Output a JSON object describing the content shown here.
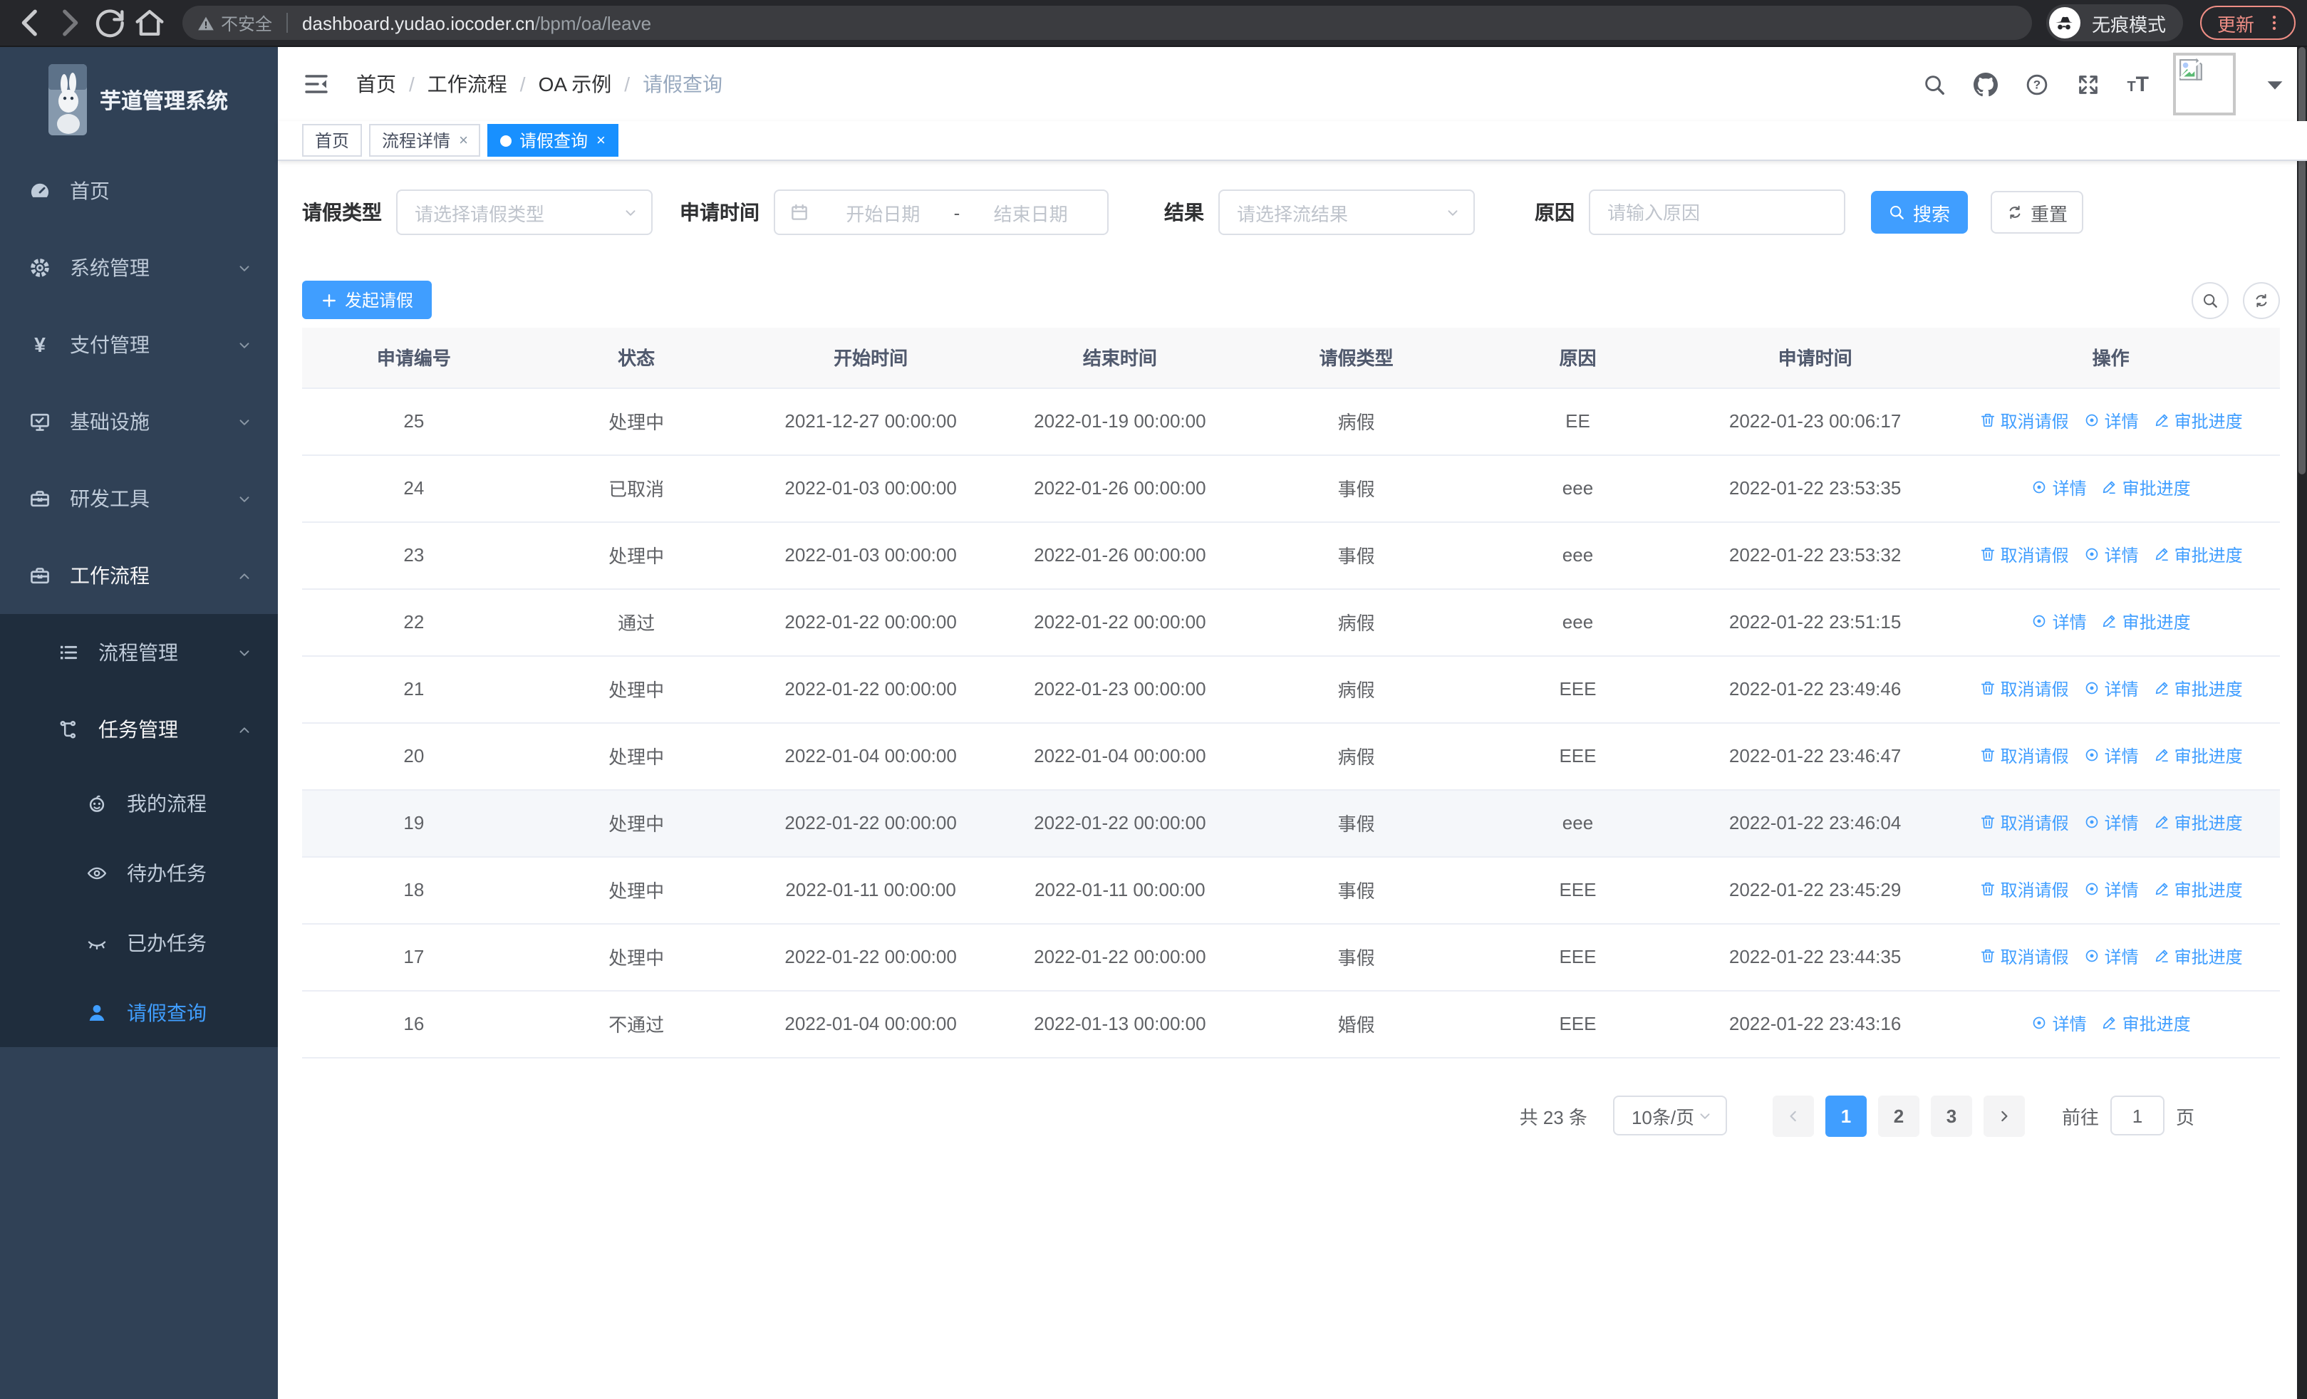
{
  "colors": {
    "primary": "#409eff",
    "tab_active": "#1890ff",
    "sidebar_bg": "#304156",
    "submenu_bg": "#1f2d3d",
    "link": "#409eff"
  },
  "browser": {
    "security_label": "不安全",
    "url_host": "dashboard.yudao.iocoder.cn",
    "url_path": "/bpm/oa/leave",
    "incognito_label": "无痕模式",
    "update_label": "更新"
  },
  "app": {
    "title": "芋道管理系统",
    "breadcrumb": [
      "首页",
      "工作流程",
      "OA 示例",
      "请假查询"
    ],
    "tabs": [
      {
        "key": "home",
        "label": "首页",
        "closable": false,
        "active": false
      },
      {
        "key": "process-detail",
        "label": "流程详情",
        "closable": true,
        "active": false
      },
      {
        "key": "leave-query",
        "label": "请假查询",
        "closable": true,
        "active": true
      }
    ]
  },
  "sidebar": {
    "items": [
      {
        "key": "home",
        "label": "首页",
        "icon": "dashboard-icon",
        "level": 1
      },
      {
        "key": "system",
        "label": "系统管理",
        "icon": "gear-icon",
        "level": 1,
        "chevron": "down"
      },
      {
        "key": "payment",
        "label": "支付管理",
        "icon": "yen-icon",
        "level": 1,
        "chevron": "down"
      },
      {
        "key": "infrastructure",
        "label": "基础设施",
        "icon": "monitor-icon",
        "level": 1,
        "chevron": "down"
      },
      {
        "key": "dev-tools",
        "label": "研发工具",
        "icon": "toolbox-icon",
        "level": 1,
        "chevron": "down"
      },
      {
        "key": "workflow",
        "label": "工作流程",
        "icon": "briefcase-icon",
        "level": 1,
        "chevron": "up",
        "open": true
      },
      {
        "key": "process-mgmt",
        "label": "流程管理",
        "icon": "list-icon",
        "level": 2,
        "chevron": "down"
      },
      {
        "key": "task-mgmt",
        "label": "任务管理",
        "icon": "tree-icon",
        "level": 2,
        "chevron": "up",
        "open": true
      },
      {
        "key": "my-process",
        "label": "我的流程",
        "icon": "robot-icon",
        "level": 3
      },
      {
        "key": "todo-task",
        "label": "待办任务",
        "icon": "eye-icon",
        "level": 3
      },
      {
        "key": "done-task",
        "label": "已办任务",
        "icon": "eye-closed-icon",
        "level": 3
      },
      {
        "key": "leave-query",
        "label": "请假查询",
        "icon": "user-icon",
        "level": 3,
        "active": true
      }
    ]
  },
  "filters": {
    "leave_type_label": "请假类型",
    "leave_type_placeholder": "请选择请假类型",
    "apply_time_label": "申请时间",
    "start_placeholder": "开始日期",
    "range_separator": "-",
    "end_placeholder": "结束日期",
    "result_label": "结果",
    "result_placeholder": "请选择流结果",
    "reason_label": "原因",
    "reason_placeholder": "请输入原因",
    "search_label": "搜索",
    "reset_label": "重置"
  },
  "toolbar": {
    "create_label": "发起请假"
  },
  "actions": {
    "cancel": {
      "label": "取消请假",
      "icon": "trash-icon"
    },
    "detail": {
      "label": "详情",
      "icon": "view-icon"
    },
    "progress": {
      "label": "审批进度",
      "icon": "edit-icon"
    }
  },
  "table": {
    "columns": [
      {
        "key": "id",
        "label": "申请编号",
        "width": "11.3%"
      },
      {
        "key": "status",
        "label": "状态",
        "width": "11.2%"
      },
      {
        "key": "start",
        "label": "开始时间",
        "width": "12.5%"
      },
      {
        "key": "end",
        "label": "结束时间",
        "width": "12.7%"
      },
      {
        "key": "type",
        "label": "请假类型",
        "width": "11.2%"
      },
      {
        "key": "reason",
        "label": "原因",
        "width": "11.2%"
      },
      {
        "key": "apply_time",
        "label": "申请时间",
        "width": "12.8%"
      },
      {
        "key": "actions",
        "label": "操作",
        "width": "17.1%"
      }
    ],
    "rows": [
      {
        "id": "25",
        "status": "处理中",
        "start": "2021-12-27 00:00:00",
        "end": "2022-01-19 00:00:00",
        "type": "病假",
        "reason": "EE",
        "apply_time": "2022-01-23 00:06:17",
        "actions": [
          "cancel",
          "detail",
          "progress"
        ],
        "highlighted": false
      },
      {
        "id": "24",
        "status": "已取消",
        "start": "2022-01-03 00:00:00",
        "end": "2022-01-26 00:00:00",
        "type": "事假",
        "reason": "eee",
        "apply_time": "2022-01-22 23:53:35",
        "actions": [
          "detail",
          "progress"
        ],
        "highlighted": false
      },
      {
        "id": "23",
        "status": "处理中",
        "start": "2022-01-03 00:00:00",
        "end": "2022-01-26 00:00:00",
        "type": "事假",
        "reason": "eee",
        "apply_time": "2022-01-22 23:53:32",
        "actions": [
          "cancel",
          "detail",
          "progress"
        ],
        "highlighted": false
      },
      {
        "id": "22",
        "status": "通过",
        "start": "2022-01-22 00:00:00",
        "end": "2022-01-22 00:00:00",
        "type": "病假",
        "reason": "eee",
        "apply_time": "2022-01-22 23:51:15",
        "actions": [
          "detail",
          "progress"
        ],
        "highlighted": false
      },
      {
        "id": "21",
        "status": "处理中",
        "start": "2022-01-22 00:00:00",
        "end": "2022-01-23 00:00:00",
        "type": "病假",
        "reason": "EEE",
        "apply_time": "2022-01-22 23:49:46",
        "actions": [
          "cancel",
          "detail",
          "progress"
        ],
        "highlighted": false
      },
      {
        "id": "20",
        "status": "处理中",
        "start": "2022-01-04 00:00:00",
        "end": "2022-01-04 00:00:00",
        "type": "病假",
        "reason": "EEE",
        "apply_time": "2022-01-22 23:46:47",
        "actions": [
          "cancel",
          "detail",
          "progress"
        ],
        "highlighted": false
      },
      {
        "id": "19",
        "status": "处理中",
        "start": "2022-01-22 00:00:00",
        "end": "2022-01-22 00:00:00",
        "type": "事假",
        "reason": "eee",
        "apply_time": "2022-01-22 23:46:04",
        "actions": [
          "cancel",
          "detail",
          "progress"
        ],
        "highlighted": true
      },
      {
        "id": "18",
        "status": "处理中",
        "start": "2022-01-11 00:00:00",
        "end": "2022-01-11 00:00:00",
        "type": "事假",
        "reason": "EEE",
        "apply_time": "2022-01-22 23:45:29",
        "actions": [
          "cancel",
          "detail",
          "progress"
        ],
        "highlighted": false
      },
      {
        "id": "17",
        "status": "处理中",
        "start": "2022-01-22 00:00:00",
        "end": "2022-01-22 00:00:00",
        "type": "事假",
        "reason": "EEE",
        "apply_time": "2022-01-22 23:44:35",
        "actions": [
          "cancel",
          "detail",
          "progress"
        ],
        "highlighted": false
      },
      {
        "id": "16",
        "status": "不通过",
        "start": "2022-01-04 00:00:00",
        "end": "2022-01-13 00:00:00",
        "type": "婚假",
        "reason": "EEE",
        "apply_time": "2022-01-22 23:43:16",
        "actions": [
          "detail",
          "progress"
        ],
        "highlighted": false
      }
    ]
  },
  "pagination": {
    "total_label": "共 23 条",
    "page_size_label": "10条/页",
    "pages": [
      "1",
      "2",
      "3"
    ],
    "active_page": "1",
    "goto_label": "前往",
    "goto_value": "1",
    "goto_unit": "页"
  }
}
